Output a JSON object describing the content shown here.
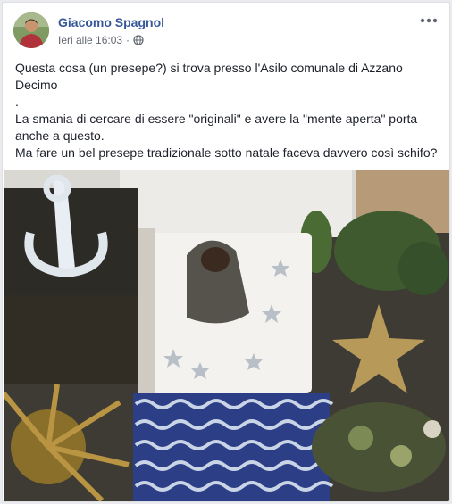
{
  "post": {
    "author": "Giacomo Spagnol",
    "timestamp": "Ieri alle 16:03",
    "separator": "·",
    "privacy_icon": "globe-icon",
    "more_icon": "more-options-icon",
    "lines": [
      "Questa cosa (un presepe?) si trova presso l'Asilo comunale di Azzano Decimo",
      ".",
      "La smania di cercare di essere \"originali\" e avere la \"mente aperta\" porta anche a questo.",
      "Ma fare un bel presepe tradizionale sotto natale faceva davvero così schifo?"
    ]
  },
  "colors": {
    "author_link": "#365899",
    "meta_text": "#616770",
    "body_text": "#1d2129",
    "card_bg": "#ffffff",
    "page_bg": "#e9ebee"
  }
}
